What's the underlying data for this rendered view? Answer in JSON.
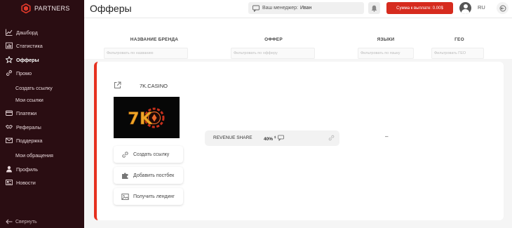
{
  "brand": {
    "logo_text": "PARTNERS"
  },
  "sidebar": {
    "items": [
      {
        "label": "Дашборд",
        "icon": "chart-line-icon"
      },
      {
        "label": "Статистика",
        "icon": "chart-bar-icon"
      },
      {
        "label": "Офферы",
        "icon": "star-icon"
      },
      {
        "label": "Промо",
        "icon": "link-icon"
      },
      {
        "label": "Создать ссылку"
      },
      {
        "label": "Мои ссылки"
      },
      {
        "label": "Платежи",
        "icon": "card-icon"
      },
      {
        "label": "Рефералы",
        "icon": "handshake-icon"
      },
      {
        "label": "Поддержка",
        "icon": "envelope-icon"
      },
      {
        "label": "Мои обращения"
      },
      {
        "label": "Профиль",
        "icon": "user-icon"
      },
      {
        "label": "Новости",
        "icon": "newspaper-icon"
      }
    ],
    "collapse_label": "Свернуть"
  },
  "topbar": {
    "title": "Офферы",
    "manager_label": "Ваш менеджер:",
    "manager_name": "Иван",
    "payout_label": "Сумма к выплате: 0.00$",
    "lang": "RU"
  },
  "table": {
    "headers": {
      "brand": "НАЗВАНИЕ БРЕНДА",
      "offer": "ОФФЕР",
      "languages": "ЯЗЫКИ",
      "geo": "ГЕО"
    },
    "filters": {
      "brand": "Фильтровать по названию",
      "offer": "Фильтровать по офферу",
      "languages": "Фильтровать по языку",
      "geo": "Фильтровать ГЕО"
    }
  },
  "offer_card": {
    "brand_name": "7K.CASINO",
    "logo_text": "7K",
    "actions": {
      "create_link": "Создать ссылку",
      "add_postback": "Добавить постбек",
      "get_landing": "Получить лендинг"
    },
    "offer_type": "REVENUE SHARE",
    "offer_percent": "40%",
    "offer_percent_sup": "$",
    "languages_value": "–"
  },
  "colors": {
    "accent": "#d62b1e",
    "sidebar_bg": "#2a0d12"
  }
}
